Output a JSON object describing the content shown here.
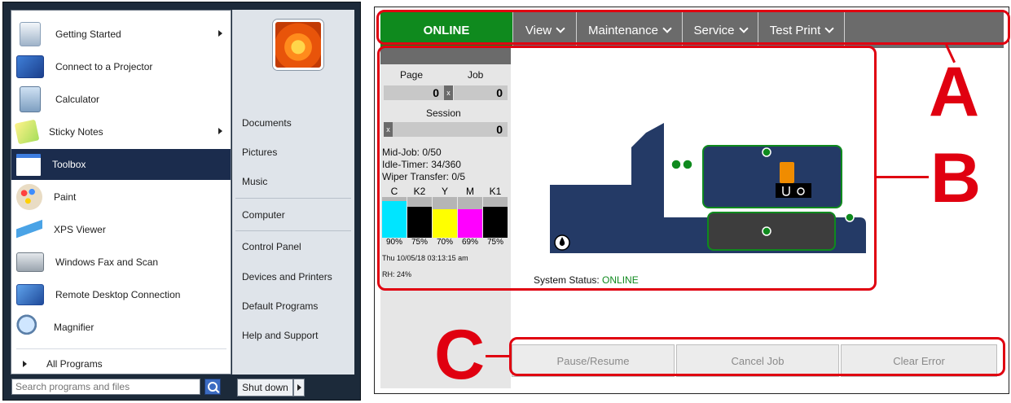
{
  "start_menu": {
    "programs": [
      {
        "label": "Getting Started",
        "icon": "getting-started-icon",
        "submenu": true
      },
      {
        "label": "Connect to a Projector",
        "icon": "projector-icon",
        "submenu": false
      },
      {
        "label": "Calculator",
        "icon": "calculator-icon",
        "submenu": false
      },
      {
        "label": "Sticky Notes",
        "icon": "sticky-notes-icon",
        "submenu": true
      },
      {
        "label": "Toolbox",
        "icon": "toolbox-icon",
        "submenu": false,
        "selected": true
      },
      {
        "label": "Paint",
        "icon": "paint-icon",
        "submenu": false
      },
      {
        "label": "XPS Viewer",
        "icon": "xps-viewer-icon",
        "submenu": false
      },
      {
        "label": "Windows Fax and Scan",
        "icon": "fax-scan-icon",
        "submenu": false
      },
      {
        "label": "Remote Desktop Connection",
        "icon": "remote-desktop-icon",
        "submenu": false
      },
      {
        "label": "Magnifier",
        "icon": "magnifier-icon",
        "submenu": false
      }
    ],
    "all_programs": "All Programs",
    "search_placeholder": "Search programs and files",
    "right_items": [
      "Documents",
      "Pictures",
      "Music",
      "Computer",
      "Control Panel",
      "Devices and Printers",
      "Default Programs",
      "Help and Support"
    ],
    "shutdown_label": "Shut down"
  },
  "printer_app": {
    "nav": {
      "status": "ONLINE",
      "menus": [
        "View",
        "Maintenance",
        "Service",
        "Test Print"
      ]
    },
    "counters": {
      "page_label": "Page",
      "job_label": "Job",
      "page_value": "0",
      "job_value": "0",
      "clear_label": "x",
      "session_label": "Session",
      "session_value": "0"
    },
    "stats": {
      "mid_job": "Mid-Job: 0/50",
      "idle_timer": "Idle-Timer: 34/360",
      "wiper_transfer": "Wiper Transfer: 0/5"
    },
    "inks": [
      {
        "name": "C",
        "percent": "90%",
        "level": 0.9,
        "color": "#00e5ff"
      },
      {
        "name": "K2",
        "percent": "75%",
        "level": 0.75,
        "color": "#000000"
      },
      {
        "name": "Y",
        "percent": "70%",
        "level": 0.7,
        "color": "#ffff00"
      },
      {
        "name": "M",
        "percent": "69%",
        "level": 0.69,
        "color": "#ff00ff"
      },
      {
        "name": "K1",
        "percent": "75%",
        "level": 0.75,
        "color": "#000000"
      }
    ],
    "timestamp": "Thu 10/05/18 03:13:15 am",
    "humidity": "RH: 24%",
    "system_status_label": "System Status:",
    "system_status_value": "ONLINE",
    "buttons": [
      "Pause/Resume",
      "Cancel Job",
      "Clear Error"
    ]
  },
  "annotations": {
    "a": "A",
    "b": "B",
    "c": "C"
  },
  "colors": {
    "online_green": "#0f8a1e",
    "annotation_red": "#e00010",
    "printer_blue": "#243a66",
    "nav_gray": "#6b6b6b"
  }
}
